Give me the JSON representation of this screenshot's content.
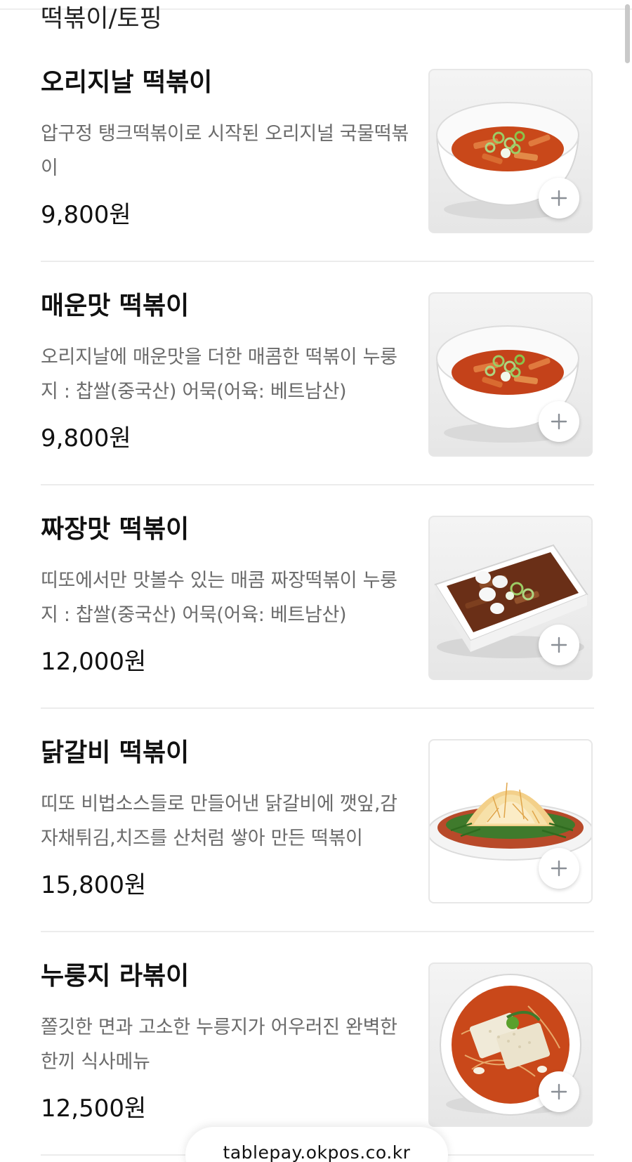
{
  "category": {
    "title": "떡볶이/토핑"
  },
  "menu": {
    "items": [
      {
        "name": "오리지날 떡볶이",
        "description": "압구정 탱크떡볶이로 시작된 오리지널 국물떡볶이",
        "price": "9,800원",
        "image_icon": "tteokbokki-bowl-image"
      },
      {
        "name": "매운맛 떡볶이",
        "description": "오리지날에 매운맛을 더한 매콤한 떡볶이 누룽지 : 찹쌀(중국산) 어묵(어육: 베트남산)",
        "price": "9,800원",
        "image_icon": "spicy-tteokbokki-bowl-image"
      },
      {
        "name": "짜장맛 떡볶이",
        "description": "띠또에서만 맛볼수 있는 매콤 짜장떡볶이 누룽지 : 찹쌀(중국산) 어묵(어육: 베트남산)",
        "price": "12,000원",
        "image_icon": "jjajang-tteokbokki-dish-image"
      },
      {
        "name": "닭갈비 떡볶이",
        "description": "띠또 비법소스들로 만들어낸 닭갈비에 깻잎,감자채튀김,치즈를 산처럼 쌓아 만든 떡볶이",
        "price": "15,800원",
        "image_icon": "dakgalbi-tteokbokki-plate-image"
      },
      {
        "name": "누룽지 라볶이",
        "description": "쫄깃한 면과 고소한 누릉지가 어우러진 완벽한 한끼 식사메뉴",
        "price": "12,500원",
        "image_icon": "nurungji-rabokki-bowl-image"
      }
    ],
    "add_icon": "plus-icon"
  },
  "footer": {
    "url": "tablepay.okpos.co.kr"
  },
  "colors": {
    "text_primary": "#111111",
    "text_secondary": "#6b6b6b",
    "divider": "#ececec",
    "sauce_red": "#c9481a",
    "jjajang_brown": "#6a2f17"
  }
}
